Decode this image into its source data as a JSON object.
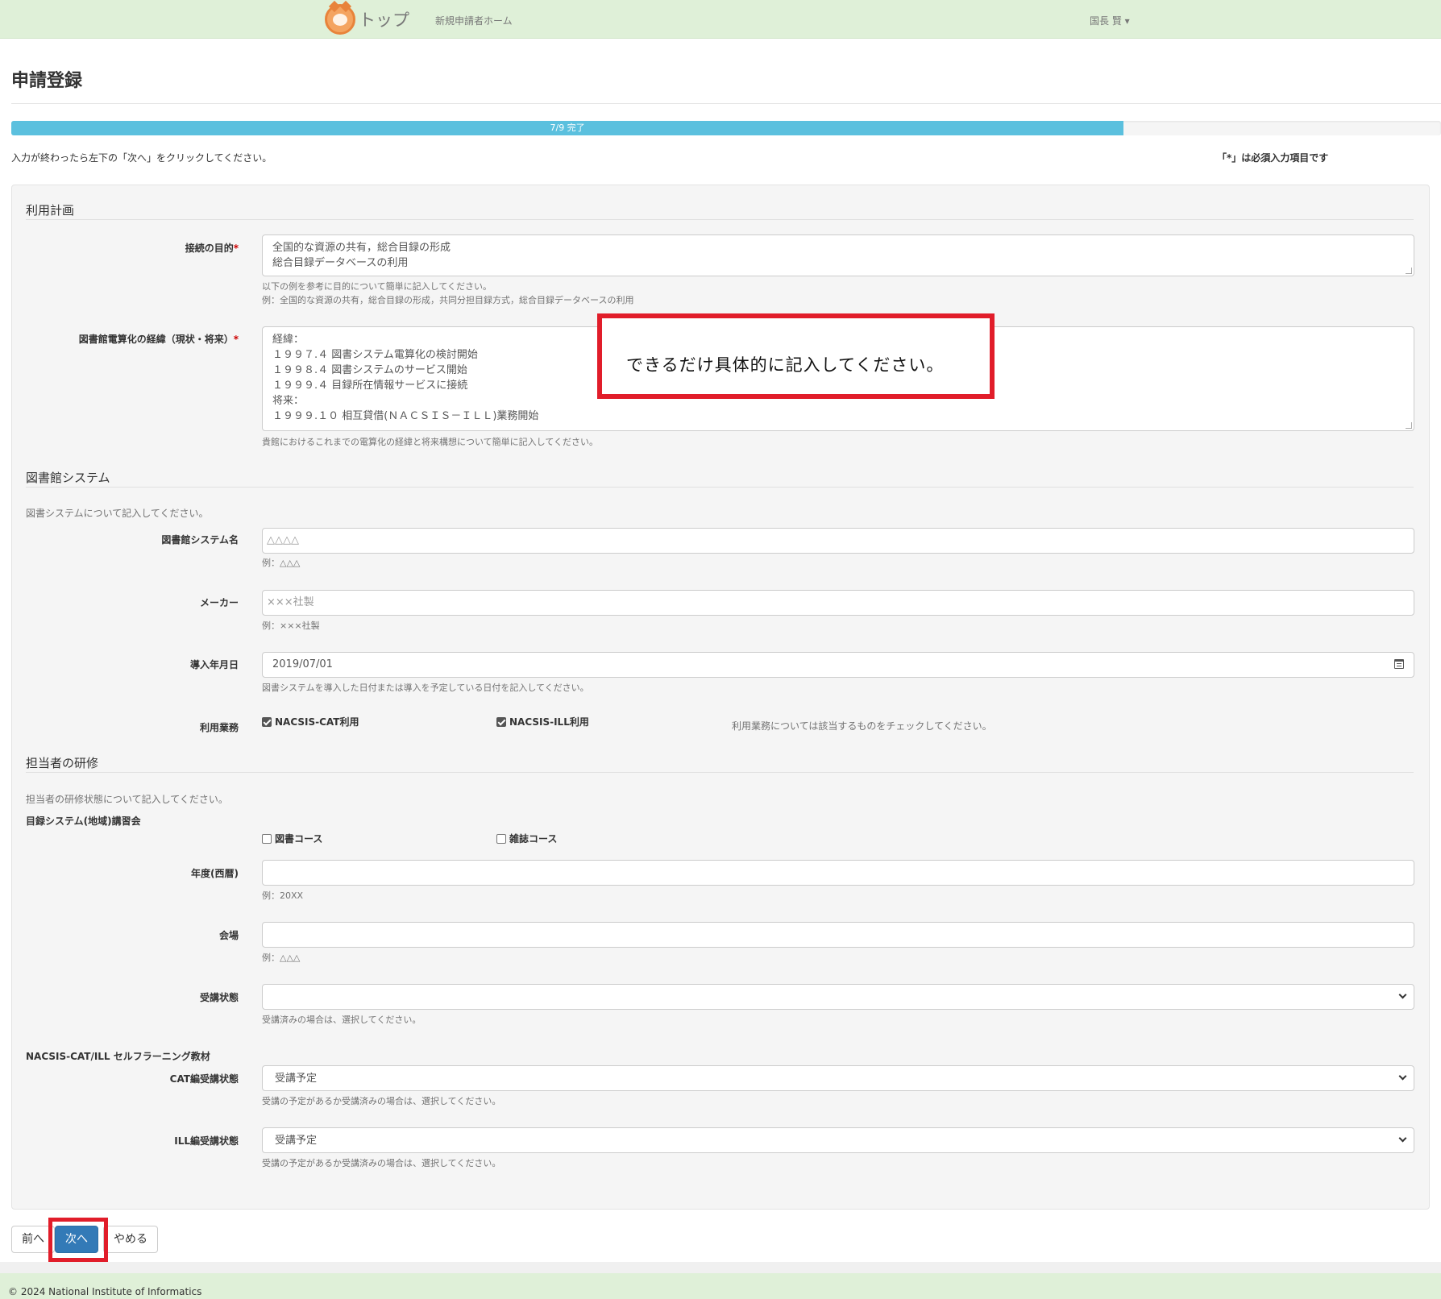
{
  "nav": {
    "brand": "トップ",
    "home_link": "新規申請者ホーム",
    "user": "国長 賢 ▾"
  },
  "page": {
    "title": "申請登録",
    "progress_label": "7/9 完了",
    "progress_percent": 77.8,
    "instruction": "入力が終わったら左下の「次へ」をクリックしてください。",
    "required_note": "「*」は必須入力項目です"
  },
  "section1": {
    "legend": "利用計画",
    "purpose": {
      "label": "接続の目的",
      "required": "*",
      "line1": "全国的な資源の共有，総合目録の形成",
      "line2": "総合目録データベースの利用",
      "help1": "以下の例を参考に目的について簡単に記入してください。",
      "help2": "例：全国的な資源の共有，総合目録の形成，共同分担目録方式，総合目録データベースの利用"
    },
    "history": {
      "label": "図書館電算化の経緯（現状・将来）",
      "required": "*",
      "value": "経緯：\n１９９７.４ 図書システム電算化の検討開始\n１９９８.４ 図書システムのサービス開始\n１９９９.４ 目録所在情報サービスに接続\n将来：\n１９９９.１０ 相互貸借(ＮＡＣＳＩＳ－ＩＬＬ)業務開始",
      "help": "貴館におけるこれまでの電算化の経緯と将来構想について簡単に記入してください。"
    }
  },
  "section2": {
    "legend": "図書館システム",
    "desc": "図書システムについて記入してください。",
    "system_name": {
      "label": "図書館システム名",
      "placeholder": "△△△△",
      "help": "例：△△△"
    },
    "maker": {
      "label": "メーカー",
      "placeholder": "×××社製",
      "help": "例：×××社製"
    },
    "date": {
      "label": "導入年月日",
      "value": "2019/07/01",
      "help": "図書システムを導入した日付または導入を予定している日付を記入してください。"
    },
    "usage": {
      "label": "利用業務",
      "opt1": "NACSIS-CAT利用",
      "opt2": "NACSIS-ILL利用",
      "help": "利用業務については該当するものをチェックしてください。"
    }
  },
  "section3": {
    "legend": "担当者の研修",
    "desc": "担当者の研修状態について記入してください。",
    "group1": "目録システム(地域)講習会",
    "course1": "図書コース",
    "course2": "雑誌コース",
    "year": {
      "label": "年度(西暦)",
      "help": "例：20XX"
    },
    "venue": {
      "label": "会場",
      "help": "例：△△△"
    },
    "status": {
      "label": "受講状態",
      "help": "受講済みの場合は、選択してください。"
    },
    "group2": "NACSIS-CAT/ILL セルフラーニング教材",
    "cat": {
      "label": "CAT編受講状態",
      "value": "受講予定",
      "help": "受講の予定があるか受講済みの場合は、選択してください。"
    },
    "ill": {
      "label": "ILL編受講状態",
      "value": "受講予定",
      "help": "受講の予定があるか受講済みの場合は、選択してください。"
    }
  },
  "callout": "できるだけ具体的に記入してください。",
  "buttons": {
    "prev": "前へ",
    "next": "次へ",
    "cancel": "やめる"
  },
  "footer": "© 2024 National Institute of Informatics",
  "colors": {
    "nav_bg": "#dff0d8",
    "progress": "#5bc0de",
    "primary": "#337ab7",
    "highlight": "#e11d2a"
  }
}
